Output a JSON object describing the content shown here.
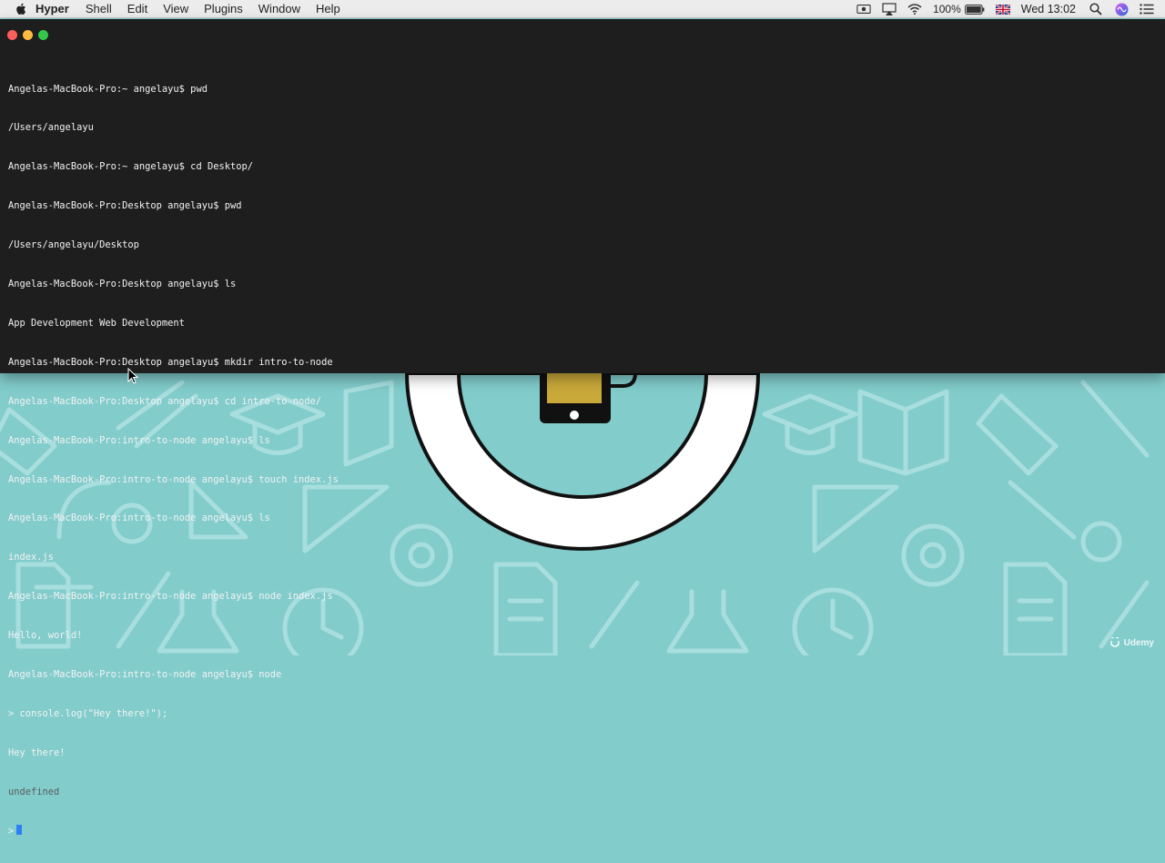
{
  "menubar": {
    "app_name": "Hyper",
    "items": [
      "Shell",
      "Edit",
      "View",
      "Plugins",
      "Window",
      "Help"
    ],
    "battery": "100%",
    "clock": "Wed 13:02",
    "icons": [
      "apple-icon",
      "screen-record-icon",
      "airplay-icon",
      "wifi-icon",
      "battery-icon",
      "flag-icon",
      "search-icon",
      "siri-icon",
      "list-icon"
    ]
  },
  "terminal": {
    "lines": [
      "Angelas-MacBook-Pro:~ angelayu$ pwd",
      "/Users/angelayu",
      "Angelas-MacBook-Pro:~ angelayu$ cd Desktop/",
      "Angelas-MacBook-Pro:Desktop angelayu$ pwd",
      "/Users/angelayu/Desktop",
      "Angelas-MacBook-Pro:Desktop angelayu$ ls",
      "App Development Web Development",
      "Angelas-MacBook-Pro:Desktop angelayu$ mkdir intro-to-node",
      "Angelas-MacBook-Pro:Desktop angelayu$ cd intro-to-node/",
      "Angelas-MacBook-Pro:intro-to-node angelayu$ ls",
      "Angelas-MacBook-Pro:intro-to-node angelayu$ touch index.js",
      "Angelas-MacBook-Pro:intro-to-node angelayu$ ls",
      "index.js",
      "Angelas-MacBook-Pro:intro-to-node angelayu$ node index.js",
      "Hello, world!",
      "Angelas-MacBook-Pro:intro-to-node angelayu$ node",
      "> console.log(\"Hey there!\");",
      "Hey there!",
      "undefined"
    ],
    "prompt": ">"
  },
  "watermark": "Udemy",
  "colors": {
    "terminal_bg": "#1e1e1e",
    "desktop_bg": "#82cccc",
    "cursor": "#2d7ff7"
  }
}
